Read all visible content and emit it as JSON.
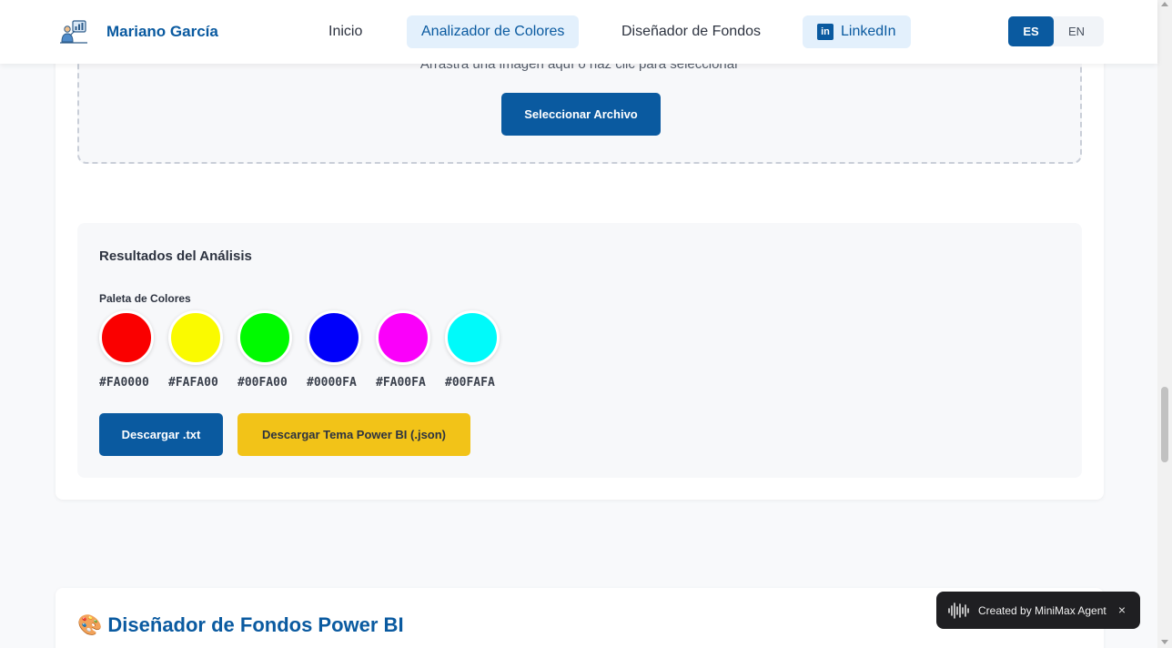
{
  "header": {
    "brand_name": "Mariano García",
    "nav": {
      "inicio": "Inicio",
      "analizador": "Analizador de Colores",
      "disenador": "Diseñador de Fondos",
      "linkedin": "LinkedIn",
      "linkedin_icon": "in"
    },
    "lang": {
      "es": "ES",
      "en": "EN",
      "active": "ES"
    }
  },
  "upload": {
    "hint": "Arrastra una imagen aquí o haz clic para seleccionar",
    "button": "Seleccionar Archivo"
  },
  "results": {
    "title": "Resultados del Análisis",
    "palette_label": "Paleta de Colores",
    "palette": [
      {
        "hex": "#FA0000"
      },
      {
        "hex": "#FAFA00"
      },
      {
        "hex": "#00FA00"
      },
      {
        "hex": "#0000FA"
      },
      {
        "hex": "#FA00FA"
      },
      {
        "hex": "#00FAFA"
      }
    ],
    "download_txt": "Descargar .txt",
    "download_json": "Descargar Tema Power BI (.json)"
  },
  "designer": {
    "emoji": "🎨",
    "title": "Diseñador de Fondos Power BI"
  },
  "toast": {
    "text": "Created by MiniMax Agent",
    "close": "×"
  },
  "colors": {
    "primary": "#0a5aa0",
    "accent": "#f2c318",
    "active_nav_bg": "#e3f0fc"
  }
}
